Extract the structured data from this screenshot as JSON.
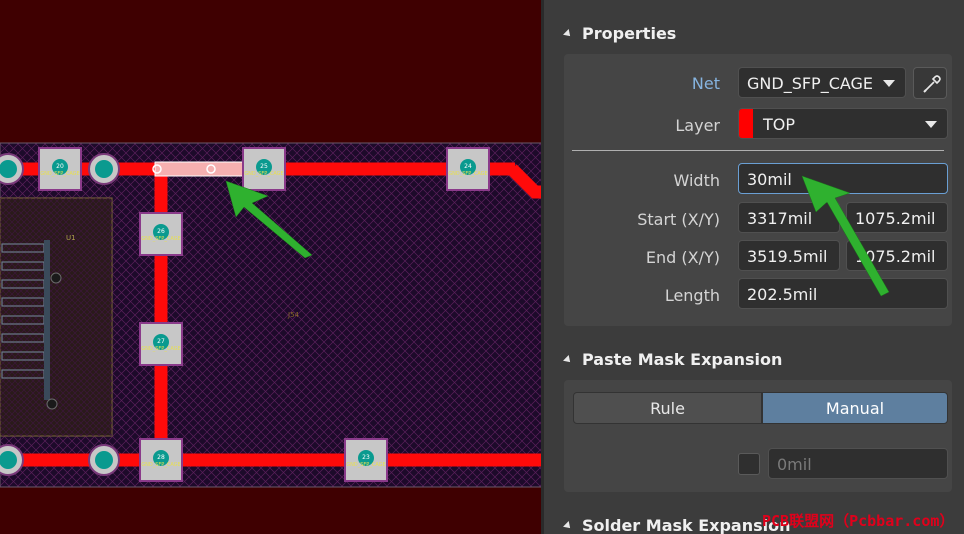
{
  "canvas": {
    "component_designator": "J54",
    "ref_label": "U1",
    "pad_net_label": "GND_SFP_CAGE",
    "pads": [
      {
        "number": "20"
      },
      {
        "number": "25"
      },
      {
        "number": "24"
      },
      {
        "number": "26"
      },
      {
        "number": "27"
      },
      {
        "number": "28"
      },
      {
        "number": "23"
      }
    ],
    "colors": {
      "background": "#3f0001",
      "copper_top": "#ff0a0a",
      "pad": "#c7c7c7",
      "via": "#0a9a8f",
      "selection_arrow": "#2fb12f"
    }
  },
  "panel": {
    "properties": {
      "title": "Properties",
      "net_label": "Net",
      "net_value": "GND_SFP_CAGE",
      "layer_label": "Layer",
      "layer_value": "TOP",
      "layer_color": "#ff0000",
      "width_label": "Width",
      "width_value": "30mil",
      "start_label": "Start (X/Y)",
      "start_x": "3317mil",
      "start_y": "1075.2mil",
      "end_label": "End (X/Y)",
      "end_x": "3519.5mil",
      "end_y": "1075.2mil",
      "length_label": "Length",
      "length_value": "202.5mil",
      "icons": {
        "net_picker": "eyedropper-icon"
      }
    },
    "paste_mask": {
      "title": "Paste Mask Expansion",
      "rule_label": "Rule",
      "manual_label": "Manual",
      "selected": "Manual",
      "value": "0mil"
    },
    "solder_mask": {
      "title": "Solder Mask Expansion"
    }
  },
  "watermark": "PCB联盟网（Pcbbar.com）"
}
